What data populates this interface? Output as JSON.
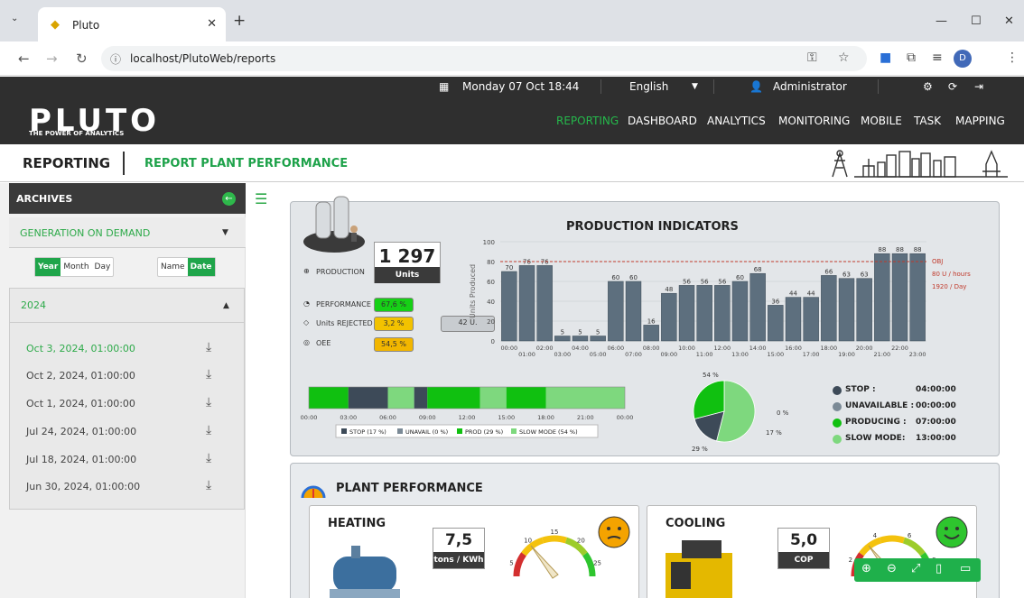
{
  "browser": {
    "tab_title": "Pluto",
    "url": "localhost/PlutoWeb/reports",
    "profile_initial": "D"
  },
  "topbar": {
    "date": "Monday 07 Oct 18:44",
    "language": "English",
    "user": "Administrator"
  },
  "header": {
    "logo": "PLUTO",
    "tagline": "THE POWER OF ANALYTICS",
    "nav": [
      "REPORTING",
      "DASHBOARD",
      "ANALYTICS",
      "MONITORING",
      "MOBILE",
      "TASK",
      "MAPPING"
    ],
    "active_nav": "REPORTING"
  },
  "subheader": {
    "section": "REPORTING",
    "page": "REPORT PLANT PERFORMANCE"
  },
  "sidebar": {
    "title": "ARCHIVES",
    "generation": "GENERATION ON DEMAND",
    "period_options": [
      "Year",
      "Month",
      "Day"
    ],
    "period_selected": "Year",
    "sort_options": [
      "Name",
      "Date"
    ],
    "sort_selected": "Date",
    "year": "2024",
    "reports": [
      {
        "date": "Oct 3, 2024, 01:00:00",
        "selected": true
      },
      {
        "date": "Oct 2, 2024, 01:00:00",
        "selected": false
      },
      {
        "date": "Oct 1, 2024, 01:00:00",
        "selected": false
      },
      {
        "date": "Jul 24, 2024, 01:00:00",
        "selected": false
      },
      {
        "date": "Jul 18, 2024, 01:00:00",
        "selected": false
      },
      {
        "date": "Jun 30, 2024, 01:00:00",
        "selected": false
      }
    ]
  },
  "production": {
    "title": "PRODUCTION INDICATORS",
    "production_label": "PRODUCTION",
    "production_value": "1 297",
    "production_unit": "Units",
    "performance_label": "PERFORMANCE",
    "performance_value": "67,6 %",
    "rejected_label": "Units REJECTED",
    "rejected_pct": "3,2 %",
    "rejected_units": "42 U.",
    "oee_label": "OEE",
    "oee_value": "54,5 %"
  },
  "chart_data": {
    "type": "bar",
    "title": "",
    "ylabel": "Units Produced",
    "ylim": [
      0,
      100
    ],
    "yticks": [
      "0",
      "20",
      "40",
      "60",
      "80",
      "100"
    ],
    "categories": [
      "00:00",
      "01:00",
      "02:00",
      "03:00",
      "04:00",
      "05:00",
      "06:00",
      "07:00",
      "08:00",
      "09:00",
      "10:00",
      "11:00",
      "12:00",
      "13:00",
      "14:00",
      "15:00",
      "16:00",
      "17:00",
      "18:00",
      "19:00",
      "20:00",
      "21:00",
      "22:00",
      "23:00"
    ],
    "values": [
      70,
      76,
      76,
      5,
      5,
      5,
      60,
      60,
      16,
      48,
      56,
      56,
      56,
      60,
      68,
      36,
      44,
      44,
      66,
      63,
      63,
      88,
      88,
      88
    ],
    "objective": 80,
    "objective_labels": [
      "OBJ",
      "80 U / hours",
      "1920 / Day"
    ],
    "colors": {
      "bar": "#5d6f7e",
      "objective": "#c0392b"
    }
  },
  "timeline": {
    "ticks": [
      "00:00",
      "03:00",
      "06:00",
      "09:00",
      "12:00",
      "15:00",
      "18:00",
      "21:00",
      "00:00"
    ],
    "segments": [
      {
        "state": "producing",
        "hours": 3
      },
      {
        "state": "stop",
        "hours": 3
      },
      {
        "state": "slow",
        "hours": 2
      },
      {
        "state": "stop",
        "hours": 1
      },
      {
        "state": "producing",
        "hours": 4
      },
      {
        "state": "slow",
        "hours": 2
      },
      {
        "state": "producing",
        "hours": 3
      },
      {
        "state": "slow",
        "hours": 6
      }
    ],
    "legend": [
      "STOP (17 %)",
      "UNAVAIL (0 %)",
      "PROD (29 %)",
      "SLOW MODE (54 %)"
    ],
    "colors": {
      "stop": "#3d4a58",
      "unavail": "#7b8a96",
      "producing": "#10c010",
      "slow": "#7ed87e"
    }
  },
  "pie": {
    "labels": [
      "54 %",
      "0 %",
      "17 %",
      "29 %"
    ],
    "values": [
      54,
      0,
      17,
      29
    ]
  },
  "status_legend": [
    {
      "label": "STOP :",
      "value": "04:00:00",
      "color": "#3d4a58"
    },
    {
      "label": "UNAVAILABLE :",
      "value": "00:00:00",
      "color": "#7b8a96"
    },
    {
      "label": "PRODUCING :",
      "value": "07:00:00",
      "color": "#10c010"
    },
    {
      "label": "SLOW MODE:",
      "value": "13:00:00",
      "color": "#7ed87e"
    }
  ],
  "plant": {
    "title": "PLANT PERFORMANCE",
    "heating": {
      "title": "HEATING",
      "value": "7,5",
      "unit": "tons / KWh",
      "gauge_ticks": [
        "5",
        "10",
        "15",
        "20",
        "25"
      ],
      "mood": "neutral"
    },
    "cooling": {
      "title": "COOLING",
      "value": "5,0",
      "unit": "COP",
      "gauge_ticks": [
        "2",
        "4",
        "6",
        "8"
      ],
      "mood": "happy"
    }
  },
  "zoom_toolbar": [
    "zoom-in",
    "zoom-out",
    "fullscreen",
    "copy",
    "comment"
  ]
}
